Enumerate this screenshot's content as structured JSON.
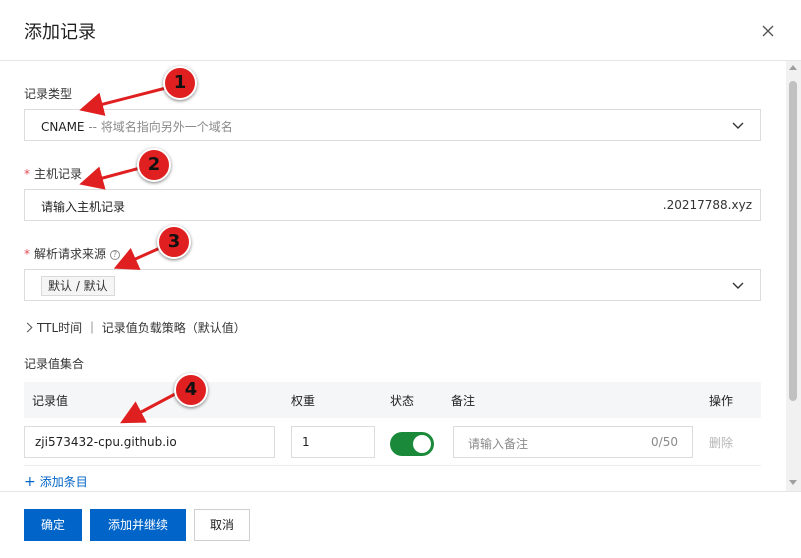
{
  "dialog": {
    "title": "添加记录"
  },
  "record_type": {
    "label": "记录类型",
    "value": "CNAME",
    "description": "-- 将域名指向另外一个域名"
  },
  "host_record": {
    "label": "主机记录",
    "placeholder": "请输入主机记录",
    "suffix": ".20217788.xyz"
  },
  "resolution_source": {
    "label": "解析请求来源",
    "value": "默认 / 默认"
  },
  "ttl_toggle": {
    "label": "TTL时间 ｜ 记录值负载策略（默认值）"
  },
  "record_set": {
    "label": "记录值集合",
    "columns": [
      "记录值",
      "权重",
      "状态",
      "备注",
      "操作"
    ],
    "rows": [
      {
        "value": "zji573432-cpu.github.io",
        "weight": "1",
        "status_enabled": true,
        "note_placeholder": "请输入备注",
        "note_counter": "0/50",
        "action": "删除"
      }
    ],
    "add_entry": "添加条目"
  },
  "footer": {
    "confirm": "确定",
    "add_continue": "添加并继续",
    "cancel": "取消"
  },
  "annotations": [
    "1",
    "2",
    "3",
    "4"
  ],
  "colors": {
    "primary": "#0064c8",
    "toggle_on": "#1a8a3a",
    "marker": "#e02020",
    "required": "#e34d59"
  }
}
